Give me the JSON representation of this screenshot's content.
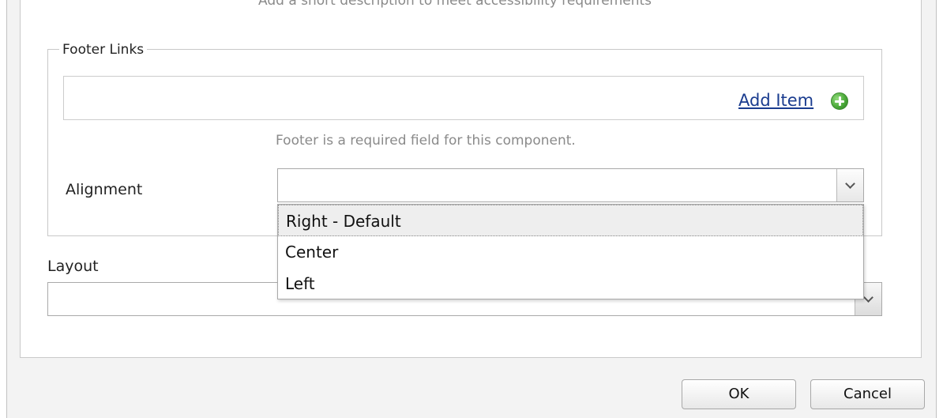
{
  "dialog": {
    "description_hint": "Add a short description to meet accessibility requirements",
    "footer_links": {
      "legend": "Footer Links",
      "add_item_label": "Add Item",
      "add_icon": "plus-circle-icon",
      "required_message": "Footer is a required field for this component."
    },
    "alignment": {
      "label": "Alignment",
      "value": "",
      "expanded": true,
      "options": [
        "Right - Default",
        "Center",
        "Left"
      ],
      "highlighted_option": "Right - Default"
    },
    "layout": {
      "label": "Layout",
      "value": ""
    },
    "buttons": {
      "ok": "OK",
      "cancel": "Cancel"
    }
  },
  "colors": {
    "link": "#1a3c8f",
    "add_icon": "#4caa3a",
    "helper_text": "#8a8a8a"
  }
}
